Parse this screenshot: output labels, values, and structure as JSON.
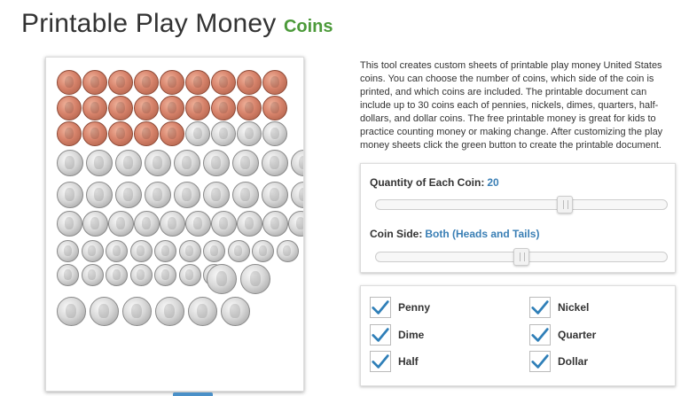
{
  "header": {
    "title": "Printable Play Money",
    "subtitle": "Coins"
  },
  "description": "This tool creates custom sheets of printable play money United States coins. You can choose the number of coins, which side of the coin is printed, and which coins are included. The printable document can include up to 30 coins each of pennies, nickels, dimes, quarters, half-dollars, and dollar coins. The free printable money is great for kids to practice counting money or making change. After customizing the play money sheets click the green button to create the printable document.",
  "sliders": {
    "quantity": {
      "label": "Quantity of Each Coin:",
      "value": "20",
      "level_fraction": 0.65
    },
    "side": {
      "label": "Coin Side:",
      "value": "Both (Heads and Tails)",
      "level_fraction": 0.5
    }
  },
  "coins": [
    {
      "label": "Penny",
      "checked": true
    },
    {
      "label": "Nickel",
      "checked": true
    },
    {
      "label": "Dime",
      "checked": true
    },
    {
      "label": "Quarter",
      "checked": true
    },
    {
      "label": "Half",
      "checked": true
    },
    {
      "label": "Dollar",
      "checked": true
    }
  ],
  "colors": {
    "accent": "#3a7fb5",
    "brand_green": "#4c9a3a",
    "check": "#2f7fb8"
  }
}
